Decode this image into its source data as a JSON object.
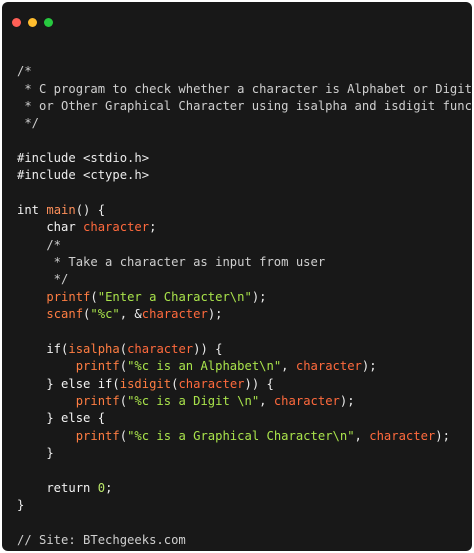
{
  "window": {
    "traffic_lights": [
      {
        "name": "close",
        "color": "#ff5f56"
      },
      {
        "name": "minimize",
        "color": "#ffbd2e"
      },
      {
        "name": "maximize",
        "color": "#27c93f"
      }
    ],
    "background": "#181818"
  },
  "code": {
    "language": "c",
    "lines": [
      [],
      [
        {
          "t": "/*",
          "c": "comment"
        }
      ],
      [
        {
          "t": " * C program to check whether a character is Alphabet or Digit",
          "c": "comment"
        }
      ],
      [
        {
          "t": " * or Other Graphical Character using isalpha and isdigit function",
          "c": "comment"
        }
      ],
      [
        {
          "t": " */",
          "c": "comment"
        }
      ],
      [],
      [
        {
          "t": "#include <stdio.h>",
          "c": "plain"
        }
      ],
      [
        {
          "t": "#include <ctype.h>",
          "c": "plain"
        }
      ],
      [],
      [
        {
          "t": "int ",
          "c": "type"
        },
        {
          "t": "main",
          "c": "func"
        },
        {
          "t": "() {",
          "c": "plain"
        }
      ],
      [
        {
          "t": "    char ",
          "c": "type"
        },
        {
          "t": "character",
          "c": "var"
        },
        {
          "t": ";",
          "c": "plain"
        }
      ],
      [
        {
          "t": "    /*",
          "c": "comment"
        }
      ],
      [
        {
          "t": "     * Take a character as input from user",
          "c": "comment"
        }
      ],
      [
        {
          "t": "     */",
          "c": "comment"
        }
      ],
      [
        {
          "t": "    ",
          "c": "plain"
        },
        {
          "t": "printf",
          "c": "fncall"
        },
        {
          "t": "(",
          "c": "plain"
        },
        {
          "t": "\"Enter a Character\\n\"",
          "c": "string"
        },
        {
          "t": ");",
          "c": "plain"
        }
      ],
      [
        {
          "t": "    ",
          "c": "plain"
        },
        {
          "t": "scanf",
          "c": "fncall"
        },
        {
          "t": "(",
          "c": "plain"
        },
        {
          "t": "\"%c\"",
          "c": "string"
        },
        {
          "t": ", &",
          "c": "plain"
        },
        {
          "t": "character",
          "c": "var"
        },
        {
          "t": ");",
          "c": "plain"
        }
      ],
      [],
      [
        {
          "t": "    if(",
          "c": "keyword"
        },
        {
          "t": "isalpha",
          "c": "fncall"
        },
        {
          "t": "(",
          "c": "plain"
        },
        {
          "t": "character",
          "c": "var"
        },
        {
          "t": ")) {",
          "c": "plain"
        }
      ],
      [
        {
          "t": "        ",
          "c": "plain"
        },
        {
          "t": "printf",
          "c": "fncall"
        },
        {
          "t": "(",
          "c": "plain"
        },
        {
          "t": "\"%c is an Alphabet\\n\"",
          "c": "string"
        },
        {
          "t": ", ",
          "c": "plain"
        },
        {
          "t": "character",
          "c": "var"
        },
        {
          "t": ");",
          "c": "plain"
        }
      ],
      [
        {
          "t": "    } else if(",
          "c": "keyword"
        },
        {
          "t": "isdigit",
          "c": "fncall"
        },
        {
          "t": "(",
          "c": "plain"
        },
        {
          "t": "character",
          "c": "var"
        },
        {
          "t": ")) {",
          "c": "plain"
        }
      ],
      [
        {
          "t": "        ",
          "c": "plain"
        },
        {
          "t": "printf",
          "c": "fncall"
        },
        {
          "t": "(",
          "c": "plain"
        },
        {
          "t": "\"%c is a Digit \\n\"",
          "c": "string"
        },
        {
          "t": ", ",
          "c": "plain"
        },
        {
          "t": "character",
          "c": "var"
        },
        {
          "t": ");",
          "c": "plain"
        }
      ],
      [
        {
          "t": "    } else {",
          "c": "keyword"
        }
      ],
      [
        {
          "t": "        ",
          "c": "plain"
        },
        {
          "t": "printf",
          "c": "fncall"
        },
        {
          "t": "(",
          "c": "plain"
        },
        {
          "t": "\"%c is a Graphical Character\\n\"",
          "c": "string"
        },
        {
          "t": ", ",
          "c": "plain"
        },
        {
          "t": "character",
          "c": "var"
        },
        {
          "t": ");",
          "c": "plain"
        }
      ],
      [
        {
          "t": "    }",
          "c": "plain"
        }
      ],
      [],
      [
        {
          "t": "    return ",
          "c": "keyword"
        },
        {
          "t": "0",
          "c": "number"
        },
        {
          "t": ";",
          "c": "plain"
        }
      ],
      [
        {
          "t": "}",
          "c": "plain"
        }
      ],
      [],
      [
        {
          "t": "// Site: BTechgeeks.com",
          "c": "comment"
        }
      ]
    ]
  }
}
